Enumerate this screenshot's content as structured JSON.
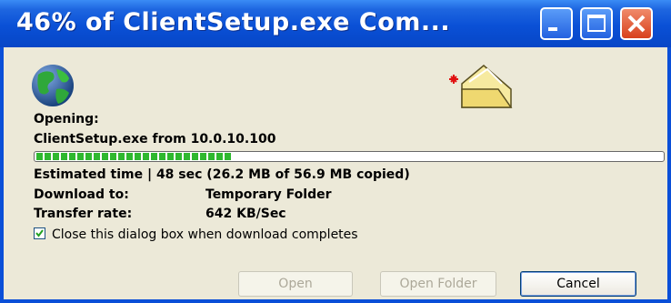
{
  "window": {
    "title": "46% of ClientSetup.exe Com...",
    "buttons": [
      "minimize-icon",
      "maximize-icon",
      "close-icon"
    ]
  },
  "icons": {
    "globe": "globe-icon",
    "folder": "folder-icon"
  },
  "opening_label": "Opening:",
  "file_source": "ClientSetup.exe from 10.0.10.100",
  "progress": {
    "percent": 46,
    "segments_filled": 24,
    "color": "#2fb82f"
  },
  "details": {
    "estimated_time": "Estimated time | 48 sec (26.2 MB of 56.9 MB copied)",
    "download_to_label": "Download to:",
    "download_to_value": "Temporary Folder",
    "transfer_rate_label": "Transfer rate:",
    "transfer_rate_value": "642 KB/Sec"
  },
  "close_when_done": {
    "checked": true,
    "label": "Close this dialog box when download completes"
  },
  "buttons": {
    "open": "Open",
    "open_folder": "Open Folder",
    "cancel": "Cancel"
  },
  "colors": {
    "titlebar": "#0a50d6",
    "dialog_bg": "#ece9d8",
    "close_button": "#d8401c"
  }
}
